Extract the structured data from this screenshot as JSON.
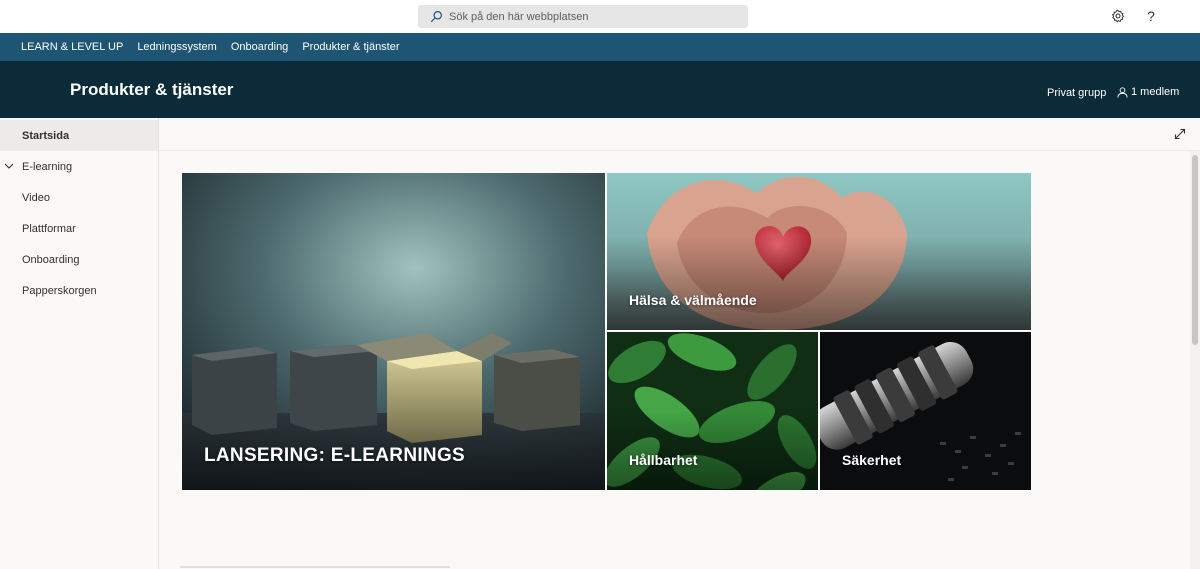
{
  "suite": {
    "search_placeholder": "Sök på den här webbplatsen",
    "help_label": "?"
  },
  "hubnav": {
    "items": [
      "LEARN & LEVEL UP",
      "Ledningssystem",
      "Onboarding",
      "Produkter & tjänster"
    ]
  },
  "site": {
    "title": "Produkter & tjänster",
    "privacy": "Privat grupp",
    "members": "1 medlem"
  },
  "leftnav": {
    "items": [
      {
        "label": "Startsida",
        "active": true
      },
      {
        "label": "E-learning",
        "expandable": true
      },
      {
        "label": "Video"
      },
      {
        "label": "Plattformar"
      },
      {
        "label": "Onboarding"
      },
      {
        "label": "Papperskorgen"
      }
    ]
  },
  "hero": {
    "tiles": [
      {
        "title": "LANSERING: E-LEARNINGS",
        "image": "glowing-open-box"
      },
      {
        "title": "Hälsa & välmående",
        "image": "hands-holding-heart"
      },
      {
        "title": "Hållbarhet",
        "image": "green-leaves"
      },
      {
        "title": "Säkerhet",
        "image": "combination-lock"
      }
    ]
  },
  "colors": {
    "hubnav_bg": "#1f5574",
    "header_bg": "#0c2b38",
    "page_bg": "#faf9f8"
  }
}
